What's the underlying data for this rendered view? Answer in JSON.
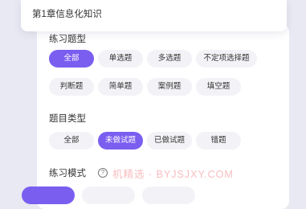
{
  "chapter": {
    "label": "第1章信息化知识"
  },
  "practice_type": {
    "title": "练习题型",
    "options": [
      "全部",
      "单选题",
      "多选题",
      "不定项选择题",
      "判断题",
      "简单题",
      "案例题",
      "填空题"
    ],
    "selected": "全部"
  },
  "question_category": {
    "title": "题目类型",
    "options": [
      "全部",
      "未做试题",
      "已做试题",
      "错题"
    ],
    "selected": "未做试题"
  },
  "practice_mode": {
    "title": "练习模式",
    "help_symbol": "?"
  },
  "watermark": {
    "text": "机精选 · BYJSJXY.COM"
  },
  "colors": {
    "accent": "#7a5ef0",
    "chip_bg": "#f3f3f7",
    "page_bg": "#e9e9f3"
  }
}
